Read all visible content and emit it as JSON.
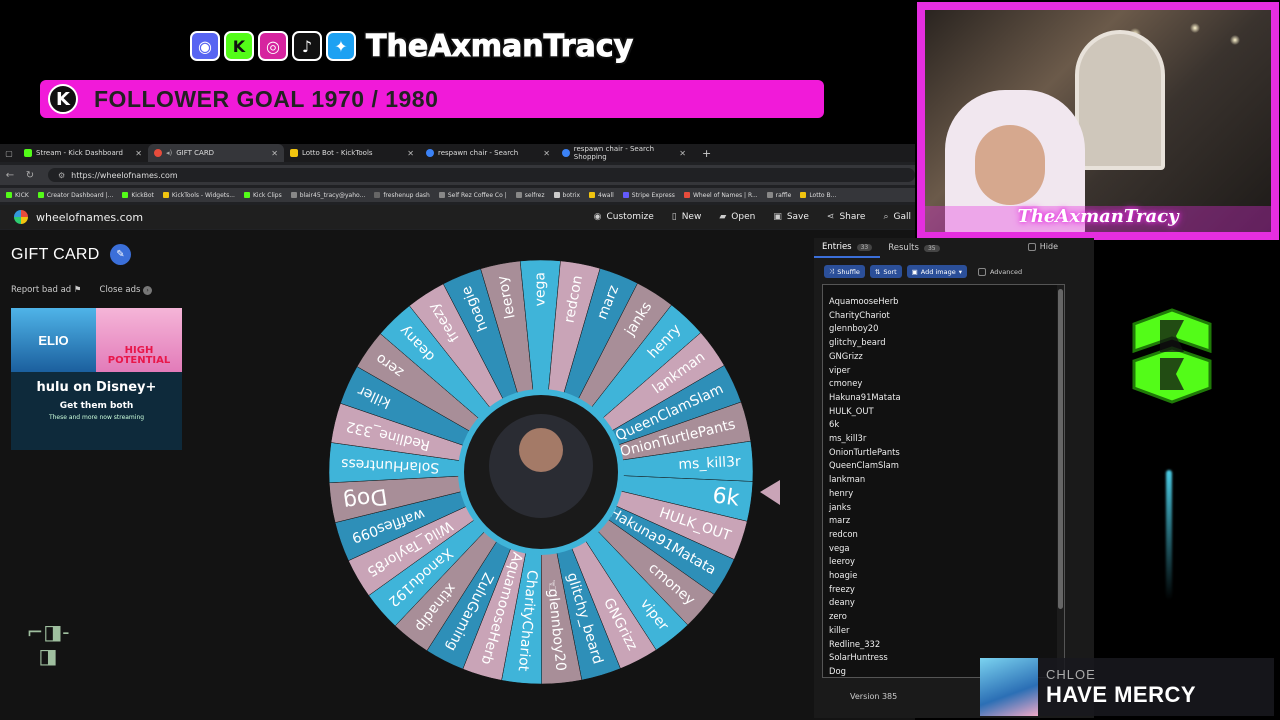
{
  "overlay": {
    "channel_name": "TheAxmanTracy",
    "social_icons": [
      "discord-icon",
      "kick-icon",
      "instagram-icon",
      "tiktok-icon",
      "twitter-icon"
    ],
    "goal_icon": "K",
    "goal_text": "FOLLOWER GOAL 1970 / 1980",
    "goal_color": "#f11ad9",
    "cam_name": "TheAxmanTracy",
    "cam_border_color": "#e52ee0",
    "music": {
      "artist": "CHLOE",
      "title": "HAVE MERCY"
    }
  },
  "browser": {
    "tabs": [
      {
        "label": "Stream - Kick Dashboard",
        "color": "#53fc18",
        "active": false
      },
      {
        "label": "GIFT CARD",
        "color": "#e74c3c",
        "active": true
      },
      {
        "label": "Lotto Bot - KickTools",
        "color": "#f1c40f",
        "active": false
      },
      {
        "label": "respawn chair - Search",
        "color": "#3b82f6",
        "active": false
      },
      {
        "label": "respawn chair - Search Shopping",
        "color": "#3b82f6",
        "active": false
      }
    ],
    "new_tab": "+",
    "url": "https://wheelofnames.com",
    "bookmarks": [
      "KICK",
      "Creator Dashboard |...",
      "KickBot",
      "KickTools - Widgets...",
      "Kick Clips",
      "blair45_tracy@yaho...",
      "freshenup dash",
      "Self Rez Coffee Co |",
      "selfrez",
      "botrix",
      "4wall",
      "Stripe Express",
      "Wheel of Names | R...",
      "raffle",
      "Lotto B..."
    ]
  },
  "site": {
    "name": "wheelofnames.com",
    "menu": [
      {
        "icon": "palette-icon",
        "label": "Customize"
      },
      {
        "icon": "new-icon",
        "label": "New"
      },
      {
        "icon": "folder-icon",
        "label": "Open"
      },
      {
        "icon": "save-icon",
        "label": "Save"
      },
      {
        "icon": "share-icon",
        "label": "Share"
      },
      {
        "icon": "search-icon",
        "label": "Gall"
      }
    ],
    "wheel_title": "GIFT CARD",
    "report_ad": "Report bad ad",
    "close_ads": "Close ads",
    "ad": {
      "elio": "ELIO",
      "high_potential": "HIGH POTENTIAL",
      "brand": "hulu on Disney+",
      "headline": "Get them both",
      "sub": "These and more now streaming"
    }
  },
  "panel": {
    "entries_tab": "Entries",
    "entries_count": "33",
    "results_tab": "Results",
    "results_count": "35",
    "hide_label": "Hide",
    "buttons": [
      "Shuffle",
      "Sort",
      "Add image"
    ],
    "advanced_label": "Advanced",
    "entries": [
      "AquamooseHerb",
      "CharityChariot",
      "glennboy20",
      "glitchy_beard",
      "GNGrizz",
      "viper",
      "cmoney",
      "Hakuna91Matata",
      "HULK_OUT",
      "6k",
      "ms_kill3r",
      "OnionTurtlePants",
      "QueenClamSlam",
      "lankman",
      "henry",
      "janks",
      "marz",
      "redcon",
      "vega",
      "leeroy",
      "hoagie",
      "freezy",
      "deany",
      "zero",
      "killer",
      "Redline_332",
      "SolarHuntress",
      "Dog"
    ],
    "version": "Version 385"
  },
  "wheel": {
    "rotation_deg": 8,
    "colors": [
      "#3fb4d9",
      "#c9a4b7",
      "#2e8fb8",
      "#a88e98"
    ],
    "segments": [
      "6k",
      "HULK_OUT",
      "Hakuna91Matata",
      "cmoney",
      "viper",
      "GNGrizz",
      "glitchy_beard",
      "glennboy20",
      "CharityChariot",
      "AquamooseHerb",
      "ZuluGaming",
      "xtinadip",
      "Xanodu192",
      "Wild_Taylor85",
      "waffles099",
      "Dog",
      "SolarHuntress",
      "Redline_332",
      "killer",
      "zero",
      "deany",
      "freezy",
      "hoagie",
      "leeroy",
      "vega",
      "redcon",
      "marz",
      "janks",
      "henry",
      "lankman",
      "QueenClamSlam",
      "OnionTurtlePants",
      "ms_kill3r"
    ]
  }
}
